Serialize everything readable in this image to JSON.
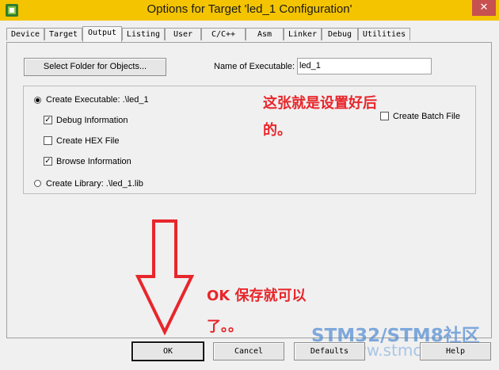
{
  "window": {
    "title": "Options for Target 'led_1 Configuration'",
    "close_label": "✕"
  },
  "tabs": [
    {
      "label": "Device"
    },
    {
      "label": "Target"
    },
    {
      "label": "Output"
    },
    {
      "label": "Listing"
    },
    {
      "label": "User"
    },
    {
      "label": "C/C++"
    },
    {
      "label": "Asm"
    },
    {
      "label": "Linker"
    },
    {
      "label": "Debug"
    },
    {
      "label": "Utilities"
    }
  ],
  "output": {
    "select_folder_label": "Select Folder for Objects...",
    "name_label": "Name of Executable:",
    "name_value": "led_1",
    "create_executable_label": "Create Executable:  .\\led_1",
    "debug_info_label": "Debug Information",
    "create_hex_label": "Create HEX File",
    "browse_info_label": "Browse Information",
    "create_library_label": "Create Library:  .\\led_1.lib",
    "create_batch_label": "Create Batch File",
    "create_executable_selected": true,
    "create_library_selected": false,
    "debug_info_checked": true,
    "create_hex_checked": false,
    "browse_info_checked": true,
    "create_batch_checked": false
  },
  "annotations": {
    "note1_line1": "这张就是设置好后",
    "note1_line2": "的。",
    "note2_line1": "OK 保存就可以",
    "note2_line2": "了。。",
    "color": "#e8262b"
  },
  "watermark": {
    "brand": "STM32/STM8社区",
    "url": "www.stmcu.org"
  },
  "buttons": {
    "ok": "OK",
    "cancel": "Cancel",
    "defaults": "Defaults",
    "help": "Help"
  },
  "colors": {
    "titlebar": "#f4c400",
    "close": "#c75050",
    "annotation": "#e8262b",
    "watermark": "#4f8bd3"
  }
}
